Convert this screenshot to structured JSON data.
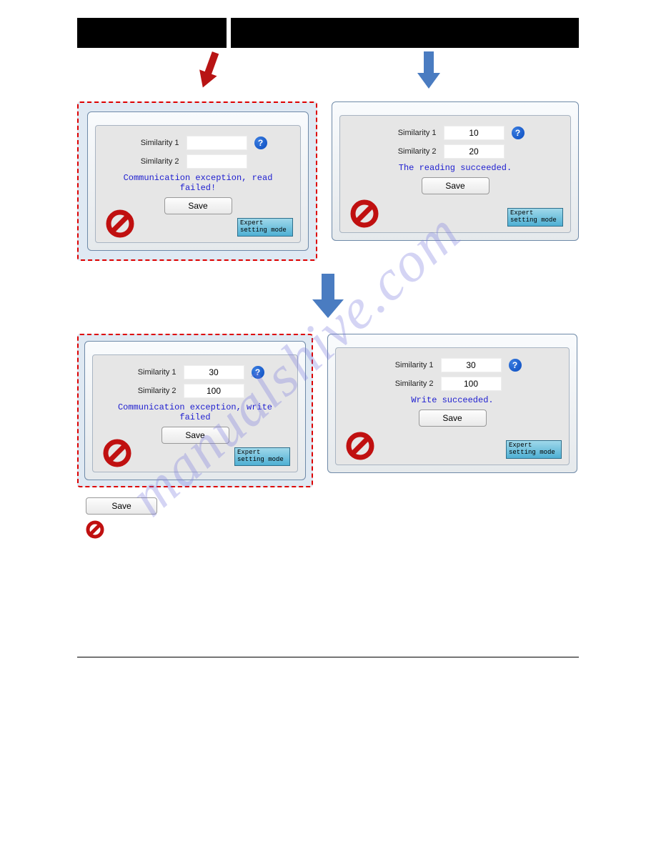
{
  "labels": {
    "similarity1": "Similarity 1",
    "similarity2": "Similarity 2",
    "save": "Save",
    "expert": "Expert setting mode",
    "expert2": "Expert setting mode",
    "help": "?"
  },
  "panels": {
    "a": {
      "status": "Communication exception, read failed!",
      "v1": "",
      "v2": ""
    },
    "b": {
      "status": "The reading succeeded.",
      "v1": "10",
      "v2": "20"
    },
    "c": {
      "status": "Communication exception, write failed",
      "v1": "30",
      "v2": "100"
    },
    "d": {
      "status": "Write succeeded.",
      "v1": "30",
      "v2": "100"
    }
  },
  "legend": {
    "save": "Save"
  },
  "watermark": "manualshive.com"
}
